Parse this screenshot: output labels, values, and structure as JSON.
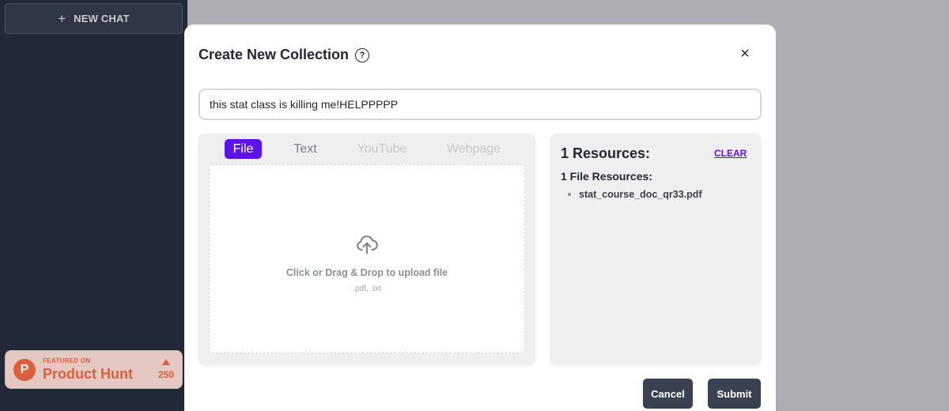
{
  "sidebar": {
    "new_chat_label": "NEW CHAT",
    "new_chat_icon": "plus-icon",
    "product_hunt": {
      "logo_letter": "P",
      "featured_text": "FEATURED ON",
      "name": "Product Hunt",
      "votes": "250",
      "color": "#d9603f"
    }
  },
  "modal": {
    "title": "Create New Collection",
    "help_icon": "?",
    "close_icon": "×",
    "collection_name_value": "this stat class is killing me!HELPPPPP",
    "tabs": [
      {
        "label": "File",
        "active": true
      },
      {
        "label": "Text",
        "active": false
      },
      {
        "label": "YouTube",
        "active": false
      },
      {
        "label": "Webpage",
        "active": false
      }
    ],
    "dropzone": {
      "icon": "cloud-upload-icon",
      "main_text": "Click or Drag & Drop to upload file",
      "sub_text": ".pdf, .txt"
    },
    "resources": {
      "title": "1 Resources:",
      "clear_label": "CLEAR",
      "file_resources_title": "1 File Resources:",
      "files": [
        "stat_course_doc_qr33.pdf"
      ]
    },
    "buttons": {
      "cancel": "Cancel",
      "submit": "Submit"
    },
    "accent_color": "#5b13e8"
  }
}
